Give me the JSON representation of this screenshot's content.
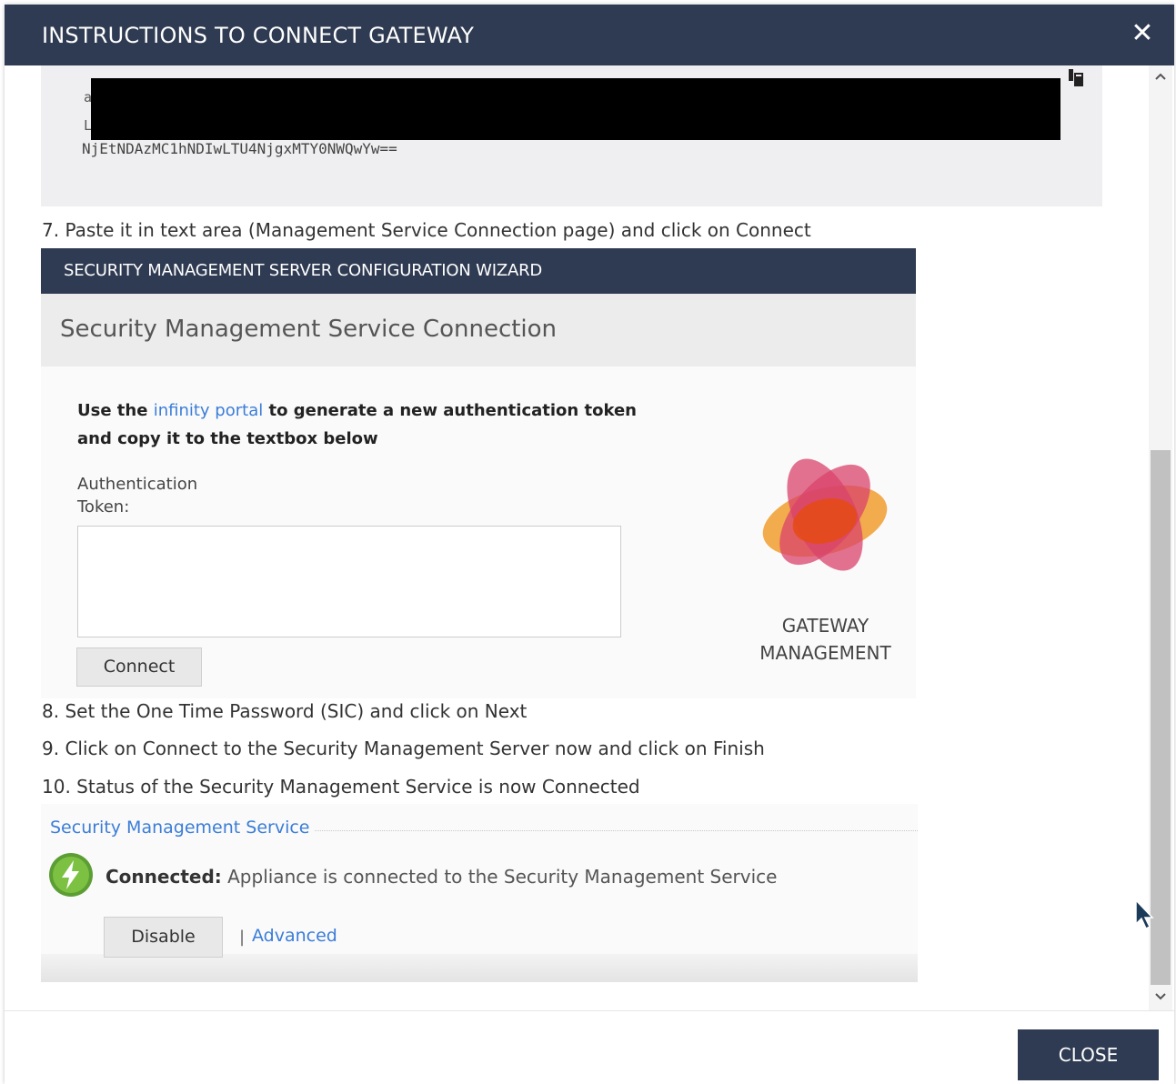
{
  "dialog": {
    "title": "INSTRUCTIONS TO CONNECT GATEWAY",
    "close_icon": "close-icon",
    "close_glyph": "✕"
  },
  "code_block": {
    "line_prefix_1": "a",
    "line_prefix_2": "L",
    "visible_line": "NjEtNDAzMC1hNDIwLTU4NjgxMTY0NWQwYw==",
    "copy_icon": "copy-icon"
  },
  "steps": {
    "step7": "7. Paste it in text area (Management Service Connection page) and click on Connect",
    "step8": "8. Set the One Time Password (SIC) and click on Next",
    "step9": "9. Click on Connect to the Security Management Server now and click on Finish",
    "step10": "10. Status of the Security Management Service is now Connected"
  },
  "wizard": {
    "header": "SECURITY MANAGEMENT SERVER CONFIGURATION WIZARD",
    "subtitle": "Security Management Service Connection",
    "desc_before": "Use the ",
    "desc_link": "infinity portal",
    "desc_after": " to generate a new authentication token and copy it to the textbox below",
    "auth_label": "Authentication Token:",
    "token_value": "",
    "connect_label": "Connect",
    "logo_line1": "GATEWAY",
    "logo_line2": "MANAGEMENT"
  },
  "sms": {
    "title": "Security Management Service",
    "status_icon": "connected-bolt-icon",
    "status_label": "Connected:",
    "status_text": " Appliance is connected to the Security Management Service",
    "disable_label": "Disable",
    "separator": "|",
    "advanced_label": "Advanced"
  },
  "footer": {
    "close_label": "CLOSE"
  },
  "colors": {
    "header_bg": "#2f3b52",
    "link": "#3b7dd8",
    "status_green": "#6ab23f"
  }
}
